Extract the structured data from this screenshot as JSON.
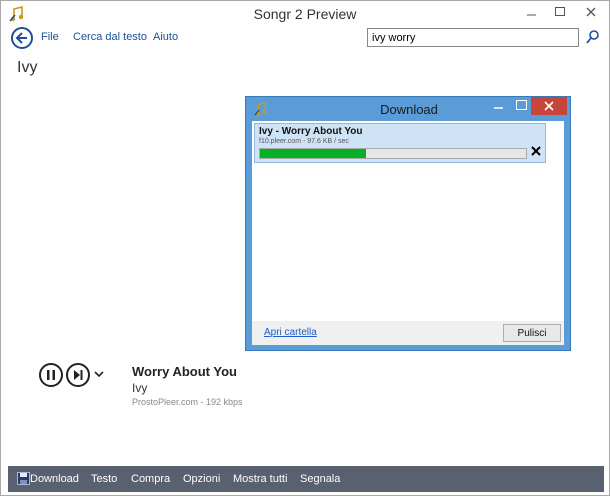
{
  "window": {
    "title": "Songr 2 Preview"
  },
  "menu": {
    "items": [
      "File",
      "Cerca dal testo",
      "Aiuto"
    ],
    "search_value": "ivy worry"
  },
  "artist_title": "Ivy",
  "player": {
    "song_title": "Worry About You",
    "artist": "Ivy",
    "source": "ProstoPleer.com - 192 kbps"
  },
  "bottom_bar": {
    "items": [
      "Download",
      "Testo",
      "Compra",
      "Opzioni",
      "Mostra tutti",
      "Segnala"
    ]
  },
  "download_dialog": {
    "title": "Download",
    "item": {
      "name": "Ivy - Worry About You",
      "info": "f10.pleer.com - 97.6 KB / sec",
      "progress": 0.4
    },
    "open_folder": "Apri cartella",
    "clean_button": "Pulisci"
  },
  "colors": {
    "accent": "#1e4f9a",
    "bottom_bar": "#596070",
    "dialog_frame": "#5a9cd8",
    "progress": "#06b025",
    "close_button": "#c7453b"
  }
}
